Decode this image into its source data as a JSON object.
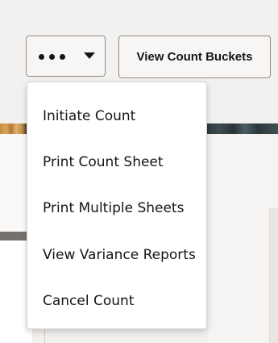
{
  "toolbar": {
    "more_actions_icon": "ellipsis-icon",
    "more_actions_caret_icon": "caret-down-icon",
    "view_count_buckets_label": "View Count Buckets"
  },
  "menu": {
    "items": [
      {
        "label": "Initiate Count"
      },
      {
        "label": "Print Count Sheet"
      },
      {
        "label": "Print Multiple Sheets"
      },
      {
        "label": "View Variance Reports"
      },
      {
        "label": "Cancel Count"
      }
    ]
  },
  "colors": {
    "page_background": "#f3f1ef",
    "text": "#161513",
    "border": "#8e8a86",
    "menu_background": "#ffffff"
  }
}
